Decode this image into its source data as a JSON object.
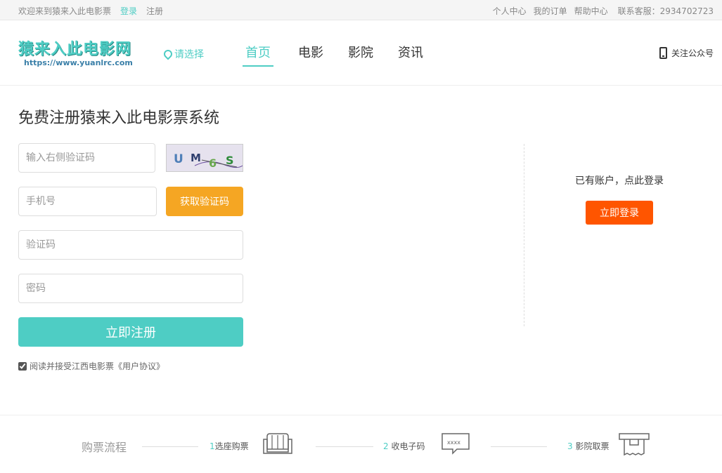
{
  "topbar": {
    "welcome": "欢迎来到猿来入此电影票",
    "login": "登录",
    "register": "注册",
    "personal_center": "个人中心",
    "my_orders": "我的订单",
    "help_center": "帮助中心",
    "service": "联系客服：2934702723"
  },
  "header": {
    "logo_name": "猿来入此电影网",
    "logo_url": "https://www.yuanlrc.com",
    "city": "请选择",
    "nav": [
      "首页",
      "电影",
      "影院",
      "资讯"
    ],
    "follow": "关注公众号"
  },
  "form": {
    "title": "免费注册猿来入此电影票系统",
    "captcha_placeholder": "输入右侧验证码",
    "captcha_text": "UM6S",
    "phone_placeholder": "手机号",
    "get_code": "获取验证码",
    "code_placeholder": "验证码",
    "password_placeholder": "密码",
    "submit": "立即注册",
    "agree_text": "阅读并接受江西电影票《用户协议》"
  },
  "side": {
    "have_account": "已有账户，点此登录",
    "login_button": "立即登录"
  },
  "process": {
    "title": "购票流程",
    "steps": [
      {
        "num": "1",
        "label": "选座购票"
      },
      {
        "num": "2",
        "label": "收电子码"
      },
      {
        "num": "3",
        "label": "影院取票"
      }
    ],
    "sms_icon_text": "xxxx"
  },
  "colors": {
    "accent": "#4ecdc4",
    "orange": "#f5a623",
    "login_red": "#ff5500"
  }
}
